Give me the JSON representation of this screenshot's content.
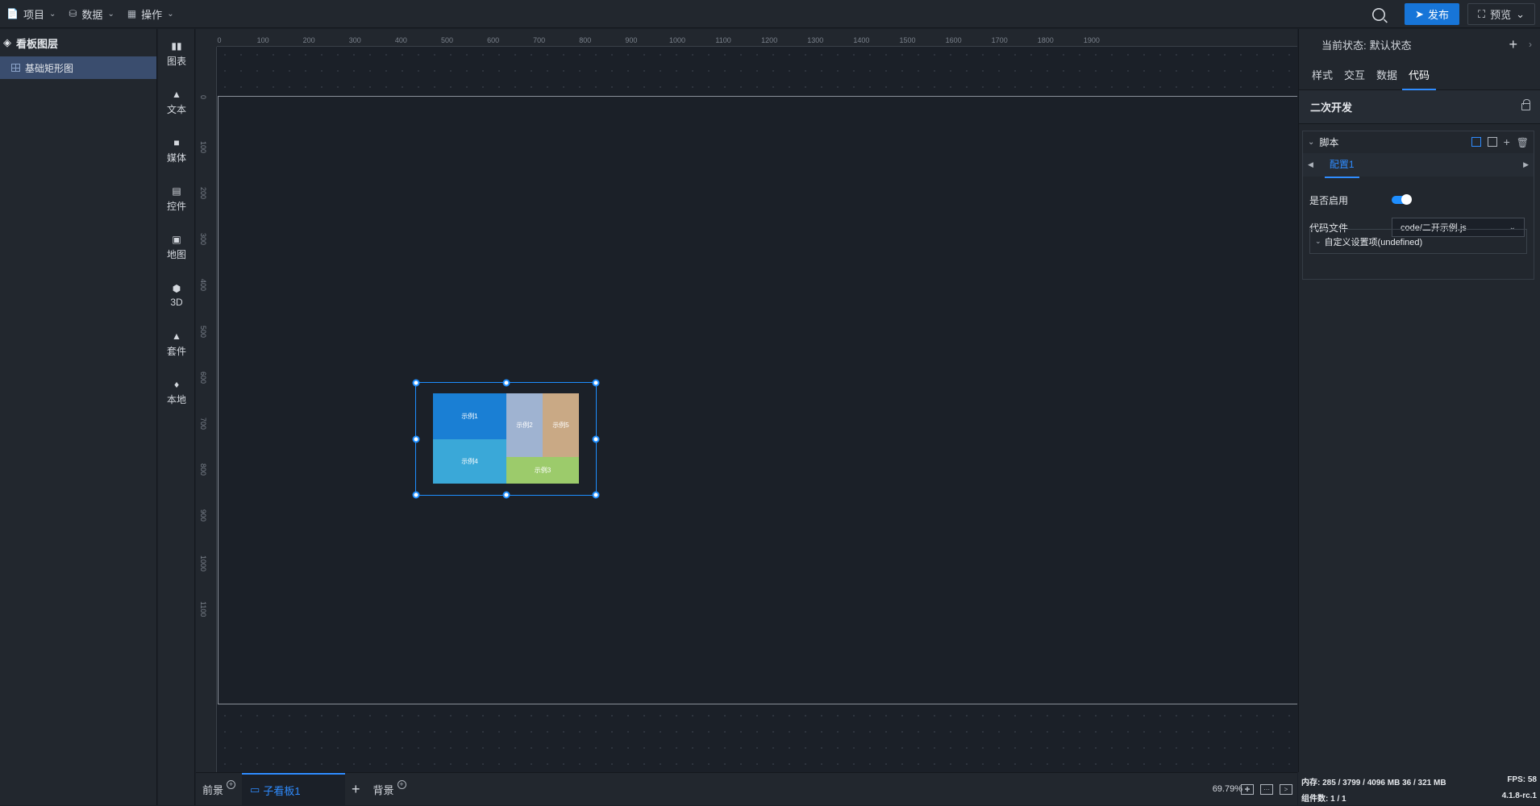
{
  "topbar": {
    "menus": [
      {
        "label": "项目"
      },
      {
        "label": "数据"
      },
      {
        "label": "操作"
      }
    ],
    "publish_label": "发布",
    "preview_label": "预览"
  },
  "layers": {
    "title": "看板图层",
    "items": [
      {
        "label": "基础矩形图"
      }
    ]
  },
  "toolbox": {
    "items": [
      {
        "label": "图表"
      },
      {
        "label": "文本"
      },
      {
        "label": "媒体"
      },
      {
        "label": "控件"
      },
      {
        "label": "地图"
      },
      {
        "label": "3D"
      },
      {
        "label": "套件"
      },
      {
        "label": "本地"
      }
    ]
  },
  "ruler": {
    "h_ticks": [
      "0",
      "100",
      "200",
      "300",
      "400",
      "500",
      "600",
      "700",
      "800",
      "900",
      "1000",
      "1100",
      "1200",
      "1300",
      "1400",
      "1500",
      "1600",
      "1700",
      "1800",
      "1900"
    ],
    "v_ticks": [
      "0",
      "100",
      "200",
      "300",
      "400",
      "500",
      "600",
      "700",
      "800",
      "900",
      "1000",
      "1100"
    ]
  },
  "treemap": {
    "cells": [
      {
        "label": "示例1",
        "color": "#1a7fd4"
      },
      {
        "label": "示例2",
        "color": "#9fb3d1"
      },
      {
        "label": "示例5",
        "color": "#c9a985"
      },
      {
        "label": "示例4",
        "color": "#3aa8d8"
      },
      {
        "label": "示例3",
        "color": "#9ccb6b"
      }
    ]
  },
  "bottombar": {
    "tabs": [
      {
        "label": "前景"
      },
      {
        "label": "子看板1"
      },
      {
        "label": "背景"
      }
    ],
    "zoom": "69.79%"
  },
  "props": {
    "state_label": "当前状态:",
    "state_value": "默认状态",
    "tabs": [
      "样式",
      "交互",
      "数据",
      "代码"
    ],
    "active_tab": "代码",
    "section_title": "二次开发",
    "script": {
      "title": "脚本",
      "config_tab": "配置1",
      "enabled_label": "是否启用",
      "enabled": true,
      "file_label": "代码文件",
      "file_value": "code/二开示例.js",
      "custom_label": "自定义设置项(undefined)"
    }
  },
  "status": {
    "memory": "内存: 285 / 3799 / 4096 MB  36 / 321 MB",
    "fps": "FPS: 58",
    "components": "组件数: 1 / 1",
    "version": "4.1.8-rc.1"
  },
  "colors": {
    "accent": "#1775d8",
    "selection": "#1e8eff"
  }
}
